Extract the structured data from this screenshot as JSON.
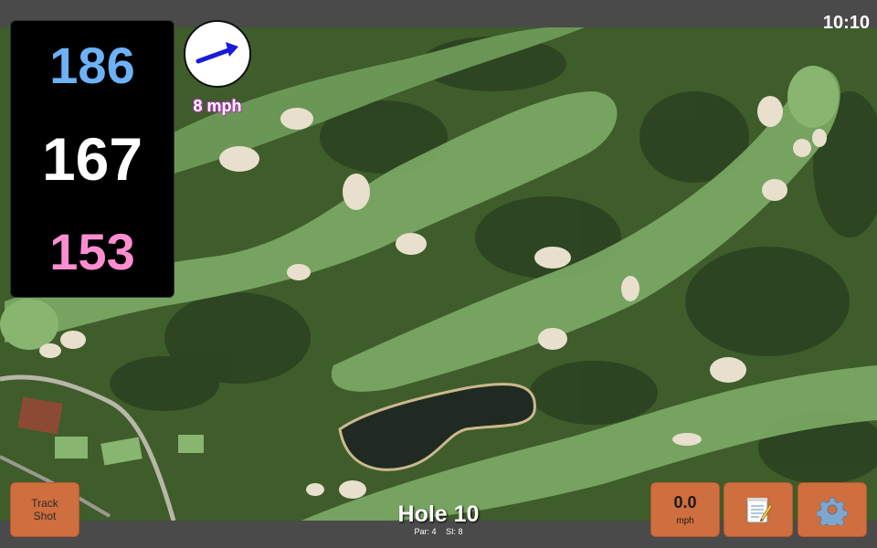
{
  "clock": "10:10",
  "yardages": {
    "back": "186",
    "middle": "167",
    "front": "153"
  },
  "wind": {
    "speed_label": "8 mph",
    "direction": "wind-arrow-icon"
  },
  "track_shot": {
    "line1": "Track",
    "line2": "Shot"
  },
  "shot_speed": {
    "value": "0.0",
    "unit": "mph"
  },
  "hole": {
    "title": "Hole 10",
    "par": "Par: 4",
    "si": "SI: 8"
  },
  "icons": {
    "notes": "notepad-icon",
    "settings": "gear-icon"
  },
  "colors": {
    "back_yardage": "#6db2f7",
    "middle_yardage": "#ffffff",
    "front_yardage": "#ff8ed1",
    "button": "#cf6e3e",
    "wind_arrow": "#1a1adb"
  }
}
